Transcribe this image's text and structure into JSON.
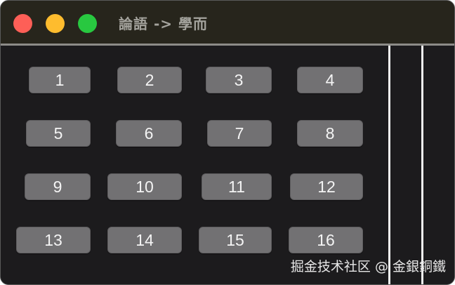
{
  "window": {
    "title": "論語 -> 學而"
  },
  "buttons": [
    {
      "label": "1"
    },
    {
      "label": "2"
    },
    {
      "label": "3"
    },
    {
      "label": "4"
    },
    {
      "label": "5"
    },
    {
      "label": "6"
    },
    {
      "label": "7"
    },
    {
      "label": "8"
    },
    {
      "label": "9"
    },
    {
      "label": "10"
    },
    {
      "label": "11"
    },
    {
      "label": "12"
    },
    {
      "label": "13"
    },
    {
      "label": "14"
    },
    {
      "label": "15"
    },
    {
      "label": "16"
    }
  ],
  "watermark": "掘金技术社区 @ 金銀銅鐵",
  "colors": {
    "close": "#fe5f57",
    "minimize": "#febc2e",
    "maximize": "#28c840",
    "button": "#727173",
    "background": "#1c1b1d"
  }
}
